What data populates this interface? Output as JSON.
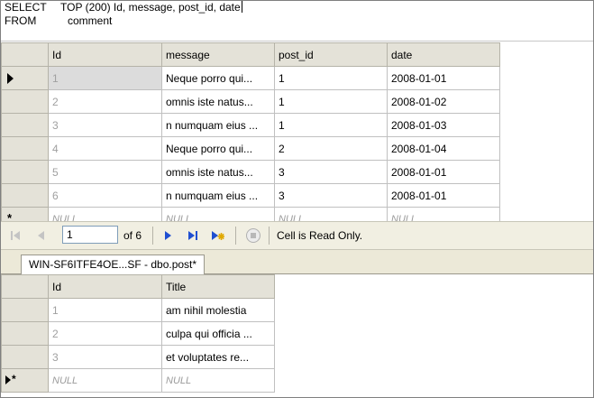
{
  "sql": {
    "line1_keyword": "SELECT",
    "line1_text": "TOP (200) Id, message, post_id, date",
    "line2_keyword": "FROM",
    "line2_text": "comment"
  },
  "comment_grid": {
    "columns": [
      "Id",
      "message",
      "post_id",
      "date"
    ],
    "rows": [
      {
        "id": "1",
        "message": "Neque porro qui...",
        "post_id": "1",
        "date": "2008-01-01"
      },
      {
        "id": "2",
        "message": " omnis iste natus...",
        "post_id": "1",
        "date": "2008-01-02"
      },
      {
        "id": "3",
        "message": "n numquam eius ...",
        "post_id": "1",
        "date": "2008-01-03"
      },
      {
        "id": "4",
        "message": "Neque porro qui...",
        "post_id": "2",
        "date": "2008-01-04"
      },
      {
        "id": "5",
        "message": " omnis iste natus...",
        "post_id": "3",
        "date": "2008-01-01"
      },
      {
        "id": "6",
        "message": "n numquam eius ...",
        "post_id": "3",
        "date": "2008-01-01"
      }
    ],
    "new_row": {
      "id": "NULL",
      "message": "NULL",
      "post_id": "NULL",
      "date": "NULL"
    }
  },
  "navigation": {
    "current_record": "1",
    "of_total": "of 6",
    "status": "Cell is Read Only."
  },
  "tab": {
    "title": "WIN-SF6ITFE4OE...SF - dbo.post*"
  },
  "post_grid": {
    "columns": [
      "Id",
      "Title"
    ],
    "rows": [
      {
        "id": "1",
        "title": "am nihil molestia"
      },
      {
        "id": "2",
        "title": " culpa qui officia ..."
      },
      {
        "id": "3",
        "title": "et voluptates re..."
      }
    ],
    "new_row": {
      "id": "NULL",
      "title": "NULL"
    }
  },
  "colors": {
    "header_bg": "#e4e2d8",
    "toolbar_bg": "#f1efe2",
    "nav_icon_blue": "#1f4fd1"
  },
  "icons": [
    "first-record-icon",
    "previous-record-icon",
    "next-record-icon",
    "last-record-icon",
    "new-record-icon",
    "stop-icon"
  ]
}
